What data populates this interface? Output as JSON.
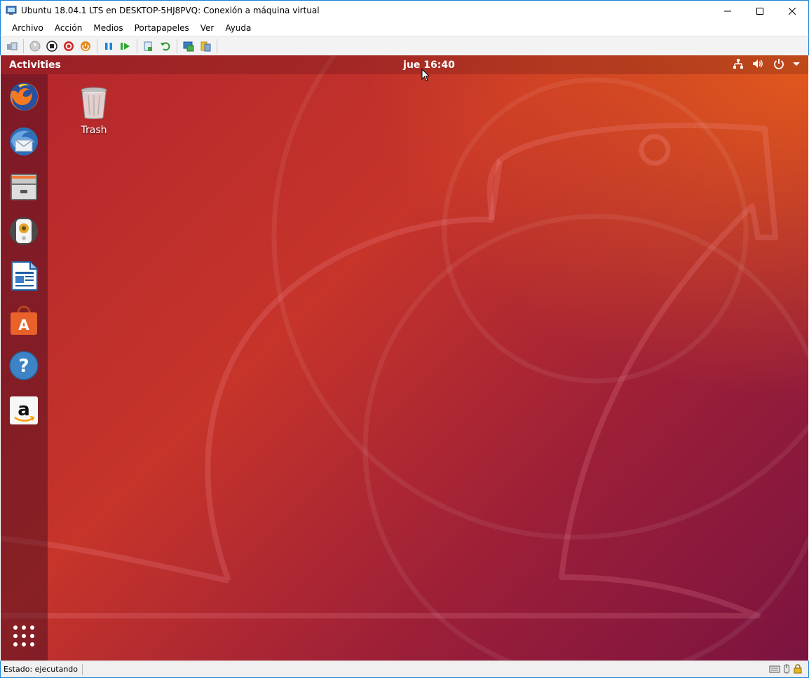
{
  "window": {
    "title": "Ubuntu 18.04.1 LTS en DESKTOP-5HJ8PVQ: Conexión a máquina virtual",
    "accent": "#1883d7"
  },
  "menubar": {
    "items": [
      "Archivo",
      "Acción",
      "Medios",
      "Portapapeles",
      "Ver",
      "Ayuda"
    ]
  },
  "toolbar": {
    "icons": [
      "ctrl-alt-del-icon",
      "start-icon",
      "turn-off-icon",
      "shutdown-icon",
      "save-state-icon",
      "pause-icon",
      "resume-icon",
      "checkpoint-icon",
      "revert-icon",
      "enhanced-session-icon",
      "share-icon"
    ]
  },
  "ubuntu": {
    "activities": "Activities",
    "clock": "jue 16:40",
    "tray": [
      "network-icon",
      "volume-icon",
      "power-icon",
      "dropdown-arrow-icon"
    ],
    "desktop_icons": [
      {
        "label": "Trash",
        "icon": "trash-icon"
      }
    ],
    "dock": [
      "firefox-icon",
      "thunderbird-icon",
      "files-icon",
      "rhythmbox-icon",
      "libreoffice-writer-icon",
      "ubuntu-software-icon",
      "help-icon",
      "amazon-icon",
      "show-applications-icon"
    ],
    "colors": {
      "wallpaper_top_right": "#e35a1c",
      "wallpaper_bottom_left": "#7b1340"
    }
  },
  "statusbar": {
    "status": "Estado: ejecutando"
  }
}
